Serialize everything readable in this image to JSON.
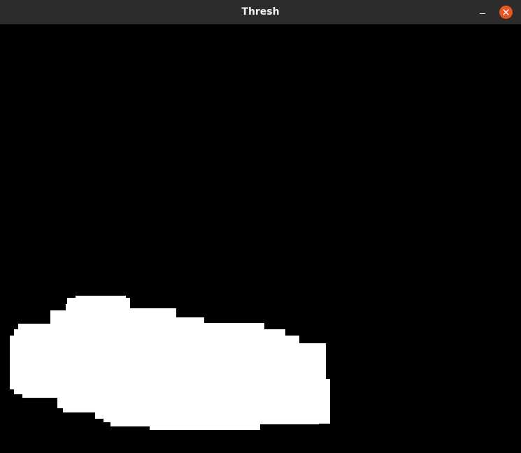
{
  "window": {
    "title": "Thresh"
  },
  "colors": {
    "titlebar": "#2c2c2c",
    "title_text": "#f2f2f2",
    "close_button": "#e95420",
    "background": "#000000",
    "foreground": "#ffffff"
  }
}
